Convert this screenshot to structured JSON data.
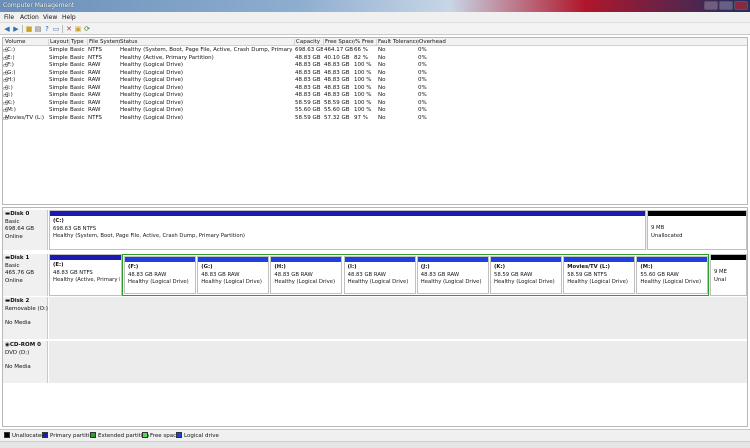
{
  "window": {
    "title": "Computer Management"
  },
  "menu": [
    "File",
    "Action",
    "View",
    "Help"
  ],
  "toolbar": {
    "icons": [
      "back-icon",
      "forward-icon",
      "up-folder-icon",
      "properties-icon",
      "help-icon",
      "delete-icon",
      "folder-icon",
      "refresh-icon",
      "window-icon"
    ]
  },
  "volume_list": {
    "columns": [
      "Volume",
      "Layout",
      "Type",
      "File System",
      "Status",
      "Capacity",
      "Free Space",
      "% Free",
      "Fault Tolerance",
      "Overhead"
    ],
    "rows": [
      [
        "(C:)",
        "Simple",
        "Basic",
        "NTFS",
        "Healthy (System, Boot, Page File, Active, Crash Dump, Primary Partition)",
        "698.63 GB",
        "464.17 GB",
        "66 %",
        "No",
        "0%"
      ],
      [
        "(E:)",
        "Simple",
        "Basic",
        "NTFS",
        "Healthy (Active, Primary Partition)",
        "48.83 GB",
        "40.10 GB",
        "82 %",
        "No",
        "0%"
      ],
      [
        "(F:)",
        "Simple",
        "Basic",
        "RAW",
        "Healthy (Logical Drive)",
        "48.83 GB",
        "48.83 GB",
        "100 %",
        "No",
        "0%"
      ],
      [
        "(G:)",
        "Simple",
        "Basic",
        "RAW",
        "Healthy (Logical Drive)",
        "48.83 GB",
        "48.83 GB",
        "100 %",
        "No",
        "0%"
      ],
      [
        "(H:)",
        "Simple",
        "Basic",
        "RAW",
        "Healthy (Logical Drive)",
        "48.83 GB",
        "48.83 GB",
        "100 %",
        "No",
        "0%"
      ],
      [
        "(I:)",
        "Simple",
        "Basic",
        "RAW",
        "Healthy (Logical Drive)",
        "48.83 GB",
        "48.83 GB",
        "100 %",
        "No",
        "0%"
      ],
      [
        "(J:)",
        "Simple",
        "Basic",
        "RAW",
        "Healthy (Logical Drive)",
        "48.83 GB",
        "48.83 GB",
        "100 %",
        "No",
        "0%"
      ],
      [
        "(K:)",
        "Simple",
        "Basic",
        "RAW",
        "Healthy (Logical Drive)",
        "58.59 GB",
        "58.59 GB",
        "100 %",
        "No",
        "0%"
      ],
      [
        "(M:)",
        "Simple",
        "Basic",
        "RAW",
        "Healthy (Logical Drive)",
        "55.60 GB",
        "55.60 GB",
        "100 %",
        "No",
        "0%"
      ],
      [
        "Movies/TV (L:)",
        "Simple",
        "Basic",
        "NTFS",
        "Healthy (Logical Drive)",
        "58.59 GB",
        "57.32 GB",
        "97 %",
        "No",
        "0%"
      ]
    ]
  },
  "disks": {
    "disk0": {
      "name": "Disk 0",
      "type": "Basic",
      "size": "698.64 GB",
      "state": "Online",
      "partitions": [
        {
          "label": "(C:)",
          "size": "698.63 GB NTFS",
          "status": "Healthy (System, Boot, Page File, Active, Crash Dump, Primary Partition)"
        },
        {
          "label": "",
          "size": "9 MB",
          "status": "Unallocated"
        }
      ]
    },
    "disk1": {
      "name": "Disk 1",
      "type": "Basic",
      "size": "465.76 GB",
      "state": "Online",
      "primary": {
        "label": "(E:)",
        "size": "48.83 GB NTFS",
        "status": "Healthy (Active, Primary Par"
      },
      "logical": [
        {
          "label": "(F:)",
          "size": "48.83 GB RAW",
          "status": "Healthy (Logical Drive)"
        },
        {
          "label": "(G:)",
          "size": "48.83 GB RAW",
          "status": "Healthy (Logical Drive)"
        },
        {
          "label": "(H:)",
          "size": "48.83 GB RAW",
          "status": "Healthy (Logical Drive)"
        },
        {
          "label": "(I:)",
          "size": "48.83 GB RAW",
          "status": "Healthy (Logical Drive)"
        },
        {
          "label": "(J:)",
          "size": "48.83 GB RAW",
          "status": "Healthy (Logical Drive)"
        },
        {
          "label": "(K:)",
          "size": "58.59 GB RAW",
          "status": "Healthy (Logical Drive)"
        },
        {
          "label": "Movies/TV (L:)",
          "size": "58.59 GB NTFS",
          "status": "Healthy (Logical Drive)"
        },
        {
          "label": "(M:)",
          "size": "55.60 GB RAW",
          "status": "Healthy (Logical Drive)"
        }
      ],
      "unallocated": {
        "size": "9 ME",
        "status": "Unal"
      }
    },
    "disk2": {
      "name": "Disk 2",
      "type": "Removable (O:)",
      "media": "No Media"
    },
    "cdrom0": {
      "name": "CD-ROM 0",
      "type": "DVD (D:)",
      "media": "No Media"
    }
  },
  "legend": [
    {
      "label": "Unallocated",
      "color": "#000000"
    },
    {
      "label": "Primary partition",
      "color": "#1a1ab0"
    },
    {
      "label": "Extended partition",
      "color": "#2aa02a"
    },
    {
      "label": "Free space",
      "color": "#5bd65b"
    },
    {
      "label": "Logical drive",
      "color": "#1f3fe0"
    }
  ]
}
